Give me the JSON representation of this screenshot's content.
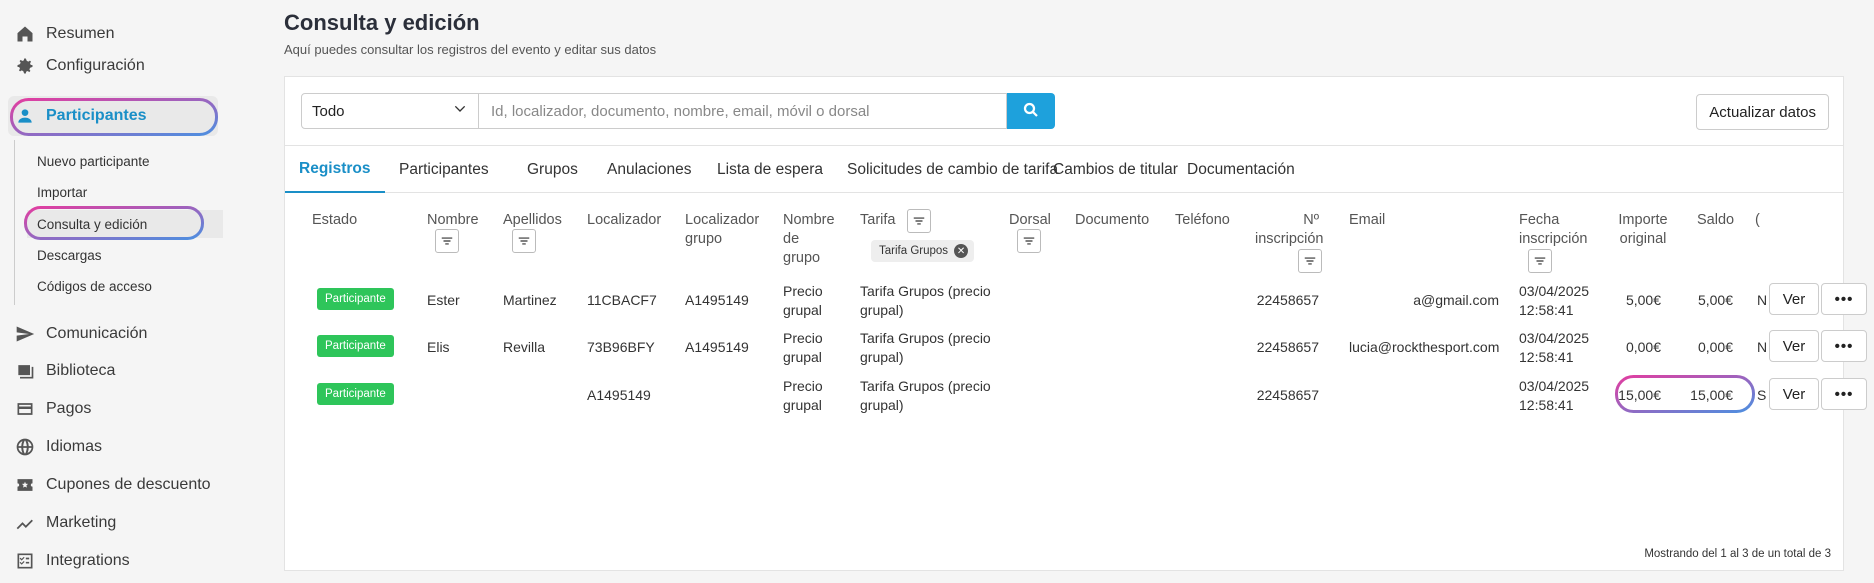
{
  "sidebar": {
    "items": [
      {
        "label": "Resumen",
        "icon": "home-icon"
      },
      {
        "label": "Configuración",
        "icon": "gear-icon"
      },
      {
        "label": "Participantes",
        "icon": "person-icon"
      },
      {
        "label": "Comunicación",
        "icon": "send-icon"
      },
      {
        "label": "Biblioteca",
        "icon": "gallery-icon"
      },
      {
        "label": "Pagos",
        "icon": "credit-card-icon"
      },
      {
        "label": "Idiomas",
        "icon": "globe-icon"
      },
      {
        "label": "Cupones de descuento",
        "icon": "coupon-icon"
      },
      {
        "label": "Marketing",
        "icon": "trend-icon"
      },
      {
        "label": "Integrations",
        "icon": "checklist-icon"
      }
    ],
    "subitems": [
      "Nuevo participante",
      "Importar",
      "Consulta y edición",
      "Descargas",
      "Códigos de acceso"
    ]
  },
  "header": {
    "title": "Consulta y edición",
    "subtitle": "Aquí puedes consultar los registros del evento y editar sus datos"
  },
  "filter": {
    "select_value": "Todo",
    "search_placeholder": "Id, localizador, documento, nombre, email, móvil o dorsal",
    "update_label": "Actualizar datos"
  },
  "tabs": [
    "Registros",
    "Participantes",
    "Grupos",
    "Anulaciones",
    "Lista de espera",
    "Solicitudes de cambio de tarifa",
    "Cambios de titular",
    "Documentación"
  ],
  "table": {
    "headers": {
      "estado": "Estado",
      "nombre": "Nombre",
      "apellidos": "Apellidos",
      "localizador": "Localizador",
      "localizador_grupo_1": "Localizador",
      "localizador_grupo_2": "grupo",
      "nombre_grupo_1": "Nombre",
      "nombre_grupo_2": "de",
      "nombre_grupo_3": "grupo",
      "tarifa": "Tarifa",
      "dorsal": "Dorsal",
      "documento": "Documento",
      "telefono": "Teléfono",
      "inscripcion_1": "Nº",
      "inscripcion_2": "inscripción",
      "email": "Email",
      "fecha_1": "Fecha",
      "fecha_2": "inscripción",
      "importe_1": "Importe",
      "importe_2": "original",
      "saldo": "Saldo",
      "cut": "("
    },
    "tarifa_chip": "Tarifa Grupos",
    "rows": [
      {
        "estado": "Participante",
        "nombre": "Ester",
        "apellidos": "Martinez",
        "localizador": "11CBACF7",
        "localizador_grupo": "A1495149",
        "nombre_grupo_1": "Precio",
        "nombre_grupo_2": "grupal",
        "tarifa_1": "Tarifa Grupos (precio",
        "tarifa_2": "grupal)",
        "inscripcion": "22458657",
        "email": "a@gmail.com",
        "fecha_1": "03/04/2025",
        "fecha_2": "12:58:41",
        "importe": "5,00€",
        "saldo": "5,00€",
        "cut": "N"
      },
      {
        "estado": "Participante",
        "nombre": "Elis",
        "apellidos": "Revilla",
        "localizador": "73B96BFY",
        "localizador_grupo": "A1495149",
        "nombre_grupo_1": "Precio",
        "nombre_grupo_2": "grupal",
        "tarifa_1": "Tarifa Grupos (precio",
        "tarifa_2": "grupal)",
        "inscripcion": "22458657",
        "email": "lucia@rockthesport.com",
        "fecha_1": "03/04/2025",
        "fecha_2": "12:58:41",
        "importe": "0,00€",
        "saldo": "0,00€",
        "cut": "N"
      },
      {
        "estado": "Participante",
        "nombre": "",
        "apellidos": "",
        "localizador": "A1495149",
        "localizador_grupo": "",
        "nombre_grupo_1": "Precio",
        "nombre_grupo_2": "grupal",
        "tarifa_1": "Tarifa Grupos (precio",
        "tarifa_2": "grupal)",
        "inscripcion": "22458657",
        "email": "",
        "fecha_1": "03/04/2025",
        "fecha_2": "12:58:41",
        "importe": "15,00€",
        "saldo": "15,00€",
        "cut": "S"
      }
    ],
    "ver_label": "Ver",
    "more_label": "•••",
    "footer": "Mostrando del 1 al 3 de un total de 3"
  },
  "colors": {
    "accent": "#1a8fc7",
    "badge": "#2ec55a",
    "search_button": "#1ea1dc",
    "ring_start": "#e23da0",
    "ring_end": "#4d8fe0"
  }
}
